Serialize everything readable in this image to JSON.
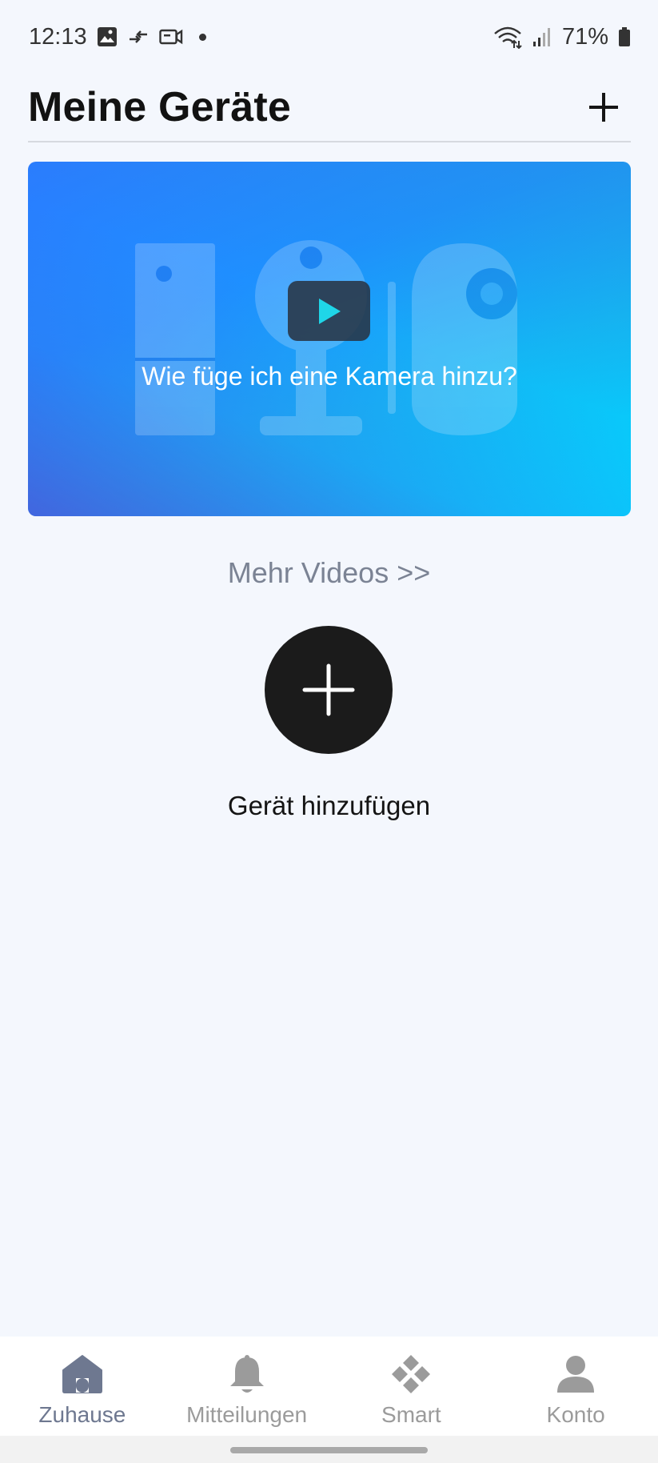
{
  "status_bar": {
    "time": "12:13",
    "battery": "71%",
    "icons": [
      "image-icon",
      "data-transfer-icon",
      "video-call-icon",
      "notification-dot",
      "wifi-icon",
      "signal-icon",
      "battery-icon"
    ]
  },
  "header": {
    "title": "Meine Geräte",
    "add_icon": "plus-icon"
  },
  "banner": {
    "caption": "Wie füge ich eine Kamera hinzu?",
    "play_icon": "play-icon"
  },
  "more_videos": "Mehr Videos >>",
  "add_device": {
    "label": "Gerät hinzufügen",
    "icon": "plus-icon"
  },
  "bottom_nav": {
    "items": [
      {
        "label": "Zuhause",
        "icon": "home-icon",
        "active": true
      },
      {
        "label": "Mitteilungen",
        "icon": "bell-icon",
        "active": false
      },
      {
        "label": "Smart",
        "icon": "smart-diamond-icon",
        "active": false
      },
      {
        "label": "Konto",
        "icon": "person-icon",
        "active": false
      }
    ]
  },
  "colors": {
    "background": "#f4f7fd",
    "accent_play": "#1fd6e8",
    "nav_active": "#6e7890",
    "nav_inactive": "#9b9b9b"
  }
}
